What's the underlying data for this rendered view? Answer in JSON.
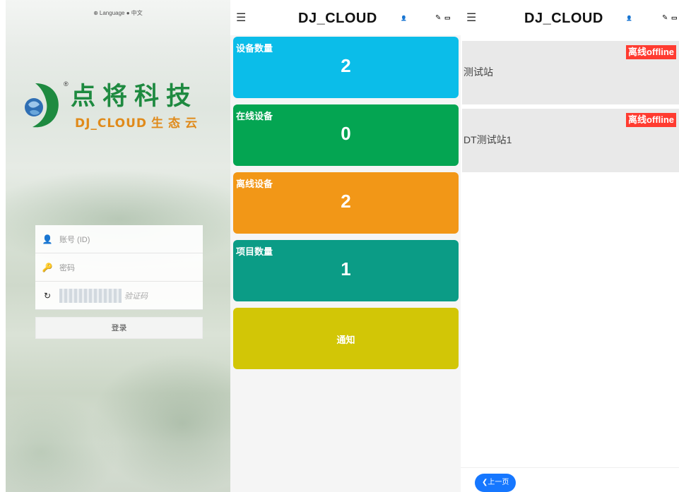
{
  "login": {
    "language_label": "Language",
    "language_value": "中文",
    "logo_cn": "点将科技",
    "logo_en": "DJ_CLOUD",
    "logo_en_suffix": "生态云",
    "account_placeholder": "账号 (ID)",
    "password_placeholder": "密码",
    "captcha_placeholder": "验证码",
    "login_button": "登录"
  },
  "dashboard": {
    "brand": "DJ_CLOUD",
    "menu_icon": "hamburger-icon",
    "cards": [
      {
        "label": "设备数量",
        "value": "2",
        "color": "#0bbde9"
      },
      {
        "label": "在线设备",
        "value": "0",
        "color": "#04a552"
      },
      {
        "label": "离线设备",
        "value": "2",
        "color": "#f29717"
      },
      {
        "label": "项目数量",
        "value": "1",
        "color": "#0b9c86"
      },
      {
        "label": "通知",
        "color": "#d2c606"
      }
    ]
  },
  "device_list": {
    "brand": "DJ_CLOUD",
    "devices": [
      {
        "name": "测试站",
        "status": "离线offline"
      },
      {
        "name": "DT测试站1",
        "status": "离线offline"
      }
    ],
    "prev_page_button": "上一页"
  }
}
